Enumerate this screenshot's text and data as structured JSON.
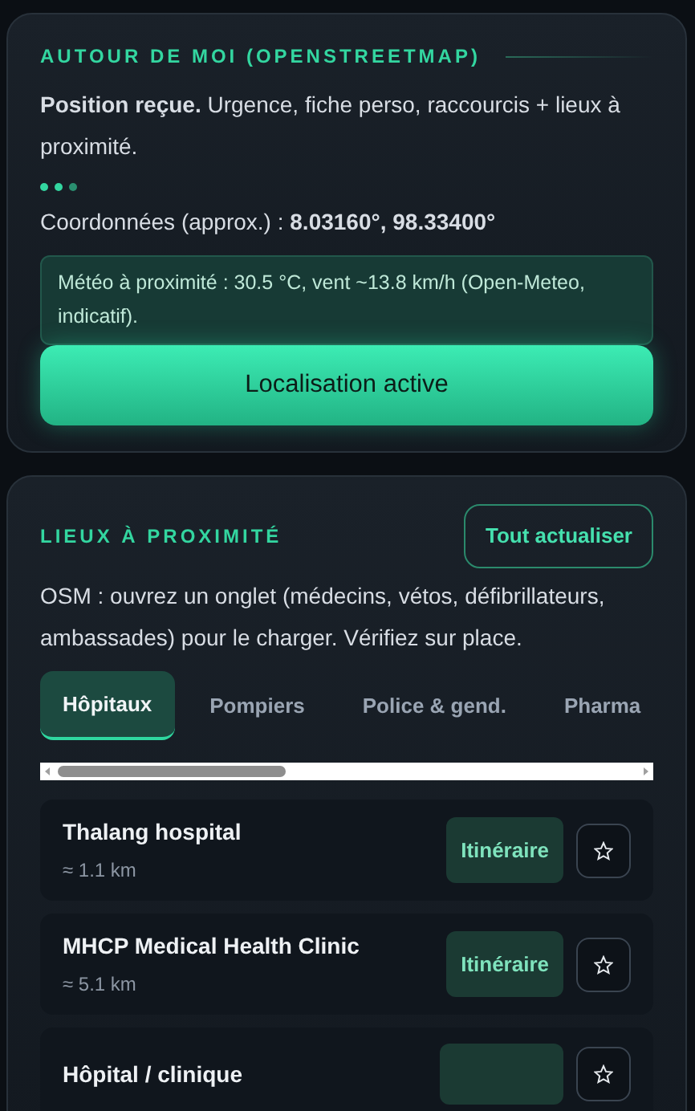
{
  "location_card": {
    "title": "AUTOUR DE MOI (OPENSTREETMAP)",
    "status": "**Position reçue.** Urgence, fiche perso, raccourcis + lieux à proximité.",
    "loading": true,
    "coordinates": "Coordonnées (approx.) : **8.03160°, 98.33400°**",
    "weather": "Météo à proximité : 30.5 °C, vent ~13.8 km/h (Open-Meteo, indicatif).",
    "button": "Localisation active"
  },
  "places_card": {
    "title": "LIEUX À PROXIMITÉ",
    "refresh_button": "Tout actualiser",
    "description": "OSM : ouvrez un onglet (médecins, vétos, défibrillateurs, ambassades) pour le charger. Vérifiez sur place.",
    "tabs": [
      {
        "label": "Hôpitaux",
        "selected": true
      },
      {
        "label": "Pompiers",
        "selected": false
      },
      {
        "label": "Police & gend.",
        "selected": false
      },
      {
        "label": "Pharma",
        "selected": false
      }
    ],
    "places": [
      {
        "name": "Thalang hospital",
        "distance": "≈ 1.1 km",
        "route_button": "Itinéraire"
      },
      {
        "name": "MHCP Medical Health Clinic",
        "distance": "≈ 5.1 km",
        "route_button": "Itinéraire"
      },
      {
        "name": "Hôpital / clinique"
      }
    ]
  }
}
